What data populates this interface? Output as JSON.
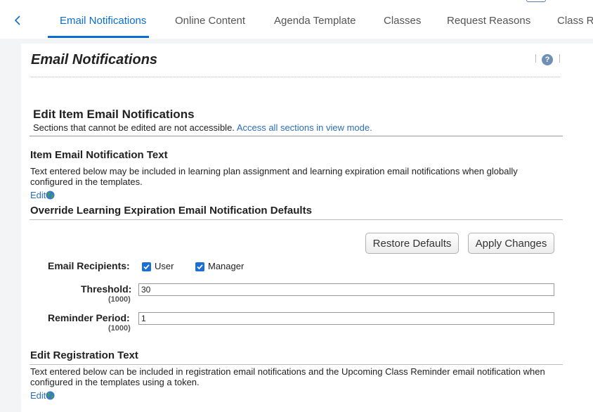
{
  "tabs": [
    {
      "label": "Email Notifications",
      "active": true
    },
    {
      "label": "Online Content"
    },
    {
      "label": "Agenda Template"
    },
    {
      "label": "Classes"
    },
    {
      "label": "Request Reasons"
    },
    {
      "label": "Class R"
    }
  ],
  "page": {
    "title": "Email Notifications",
    "help_glyph": "?"
  },
  "edit_section": {
    "heading": "Edit Item Email Notifications",
    "note": "Sections that cannot be edited are not accessible. ",
    "link": "Access all sections in view mode."
  },
  "item_text": {
    "heading": "Item Email Notification Text",
    "description": "Text entered below may be included in learning plan assignment and learning expiration email notifications when globally configured in the templates.",
    "edit_label": "Edit"
  },
  "override": {
    "heading": "Override Learning Expiration Email Notification Defaults",
    "restore_label": "Restore Defaults",
    "apply_label": "Apply Changes",
    "recipients_label": "Email Recipients:",
    "recipients": [
      {
        "label": "User",
        "checked": true
      },
      {
        "label": "Manager",
        "checked": true
      }
    ],
    "threshold_label": "Threshold:",
    "threshold_hint": "(1000)",
    "threshold_value": "30",
    "reminder_label": "Reminder Period:",
    "reminder_hint": "(1000)",
    "reminder_value": "1"
  },
  "registration": {
    "heading": "Edit Registration Text",
    "description": "Text entered below can be included in registration email notifications and the Upcoming Class Reminder email notification when configured in the templates using a token.",
    "edit_label": "Edit"
  },
  "colors": {
    "accent": "#0a6ed1",
    "link": "#2a6ebb",
    "checkbox": "#1a6fd6"
  },
  "icons": [
    "chevron-left-icon",
    "help-icon",
    "globe-icon",
    "checkmark-icon"
  ]
}
